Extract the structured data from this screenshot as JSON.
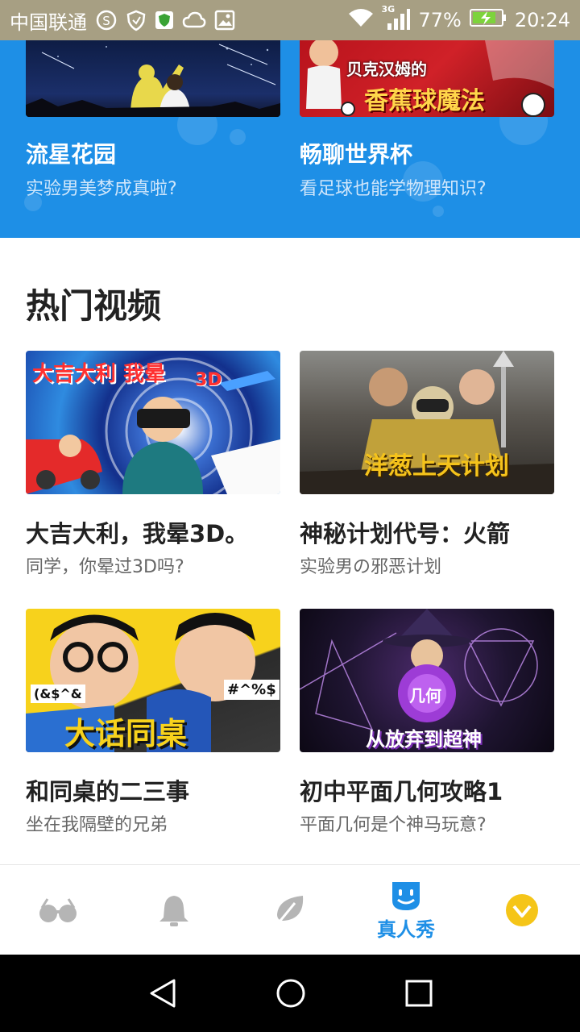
{
  "status_bar": {
    "carrier": "中国联通",
    "network": "3G",
    "battery": "77%",
    "time": "20:24"
  },
  "featured": [
    {
      "title": "流星花园",
      "subtitle": "实验男美梦成真啦?"
    },
    {
      "title": "畅聊世界杯",
      "subtitle": "看足球也能学物理知识?",
      "thumb_text_top": "贝克汉姆的",
      "thumb_text_bottom": "香蕉球魔法"
    }
  ],
  "hot_videos": {
    "section_title": "热门视频",
    "items": [
      {
        "title": "大吉大利，我晕3D。",
        "subtitle": "同学，你晕过3D吗?",
        "thumb_text": "大吉大利 我晕",
        "thumb_text_2": "3D"
      },
      {
        "title": "神秘计划代号：火箭",
        "subtitle": "实验男の邪恶计划",
        "thumb_text": "洋葱上天计划"
      },
      {
        "title": "和同桌的二三事",
        "subtitle": "坐在我隔壁的兄弟",
        "thumb_text": "大话同桌",
        "thumb_text_2": "(&$^&",
        "thumb_text_3": "#^%$"
      },
      {
        "title": "初中平面几何攻略1",
        "subtitle": "平面几何是个神马玩意?",
        "thumb_text": "从放弃到超神",
        "thumb_text_2": "几何"
      }
    ]
  },
  "bottom_nav": {
    "active_label": "真人秀",
    "accent": "#1e8fe6"
  },
  "colors": {
    "status_bar": "#a79f83",
    "featured_bg": "#1e8fe6",
    "title_text": "#222222",
    "subtitle_text": "#666666",
    "vip_yellow": "#f5c518"
  }
}
